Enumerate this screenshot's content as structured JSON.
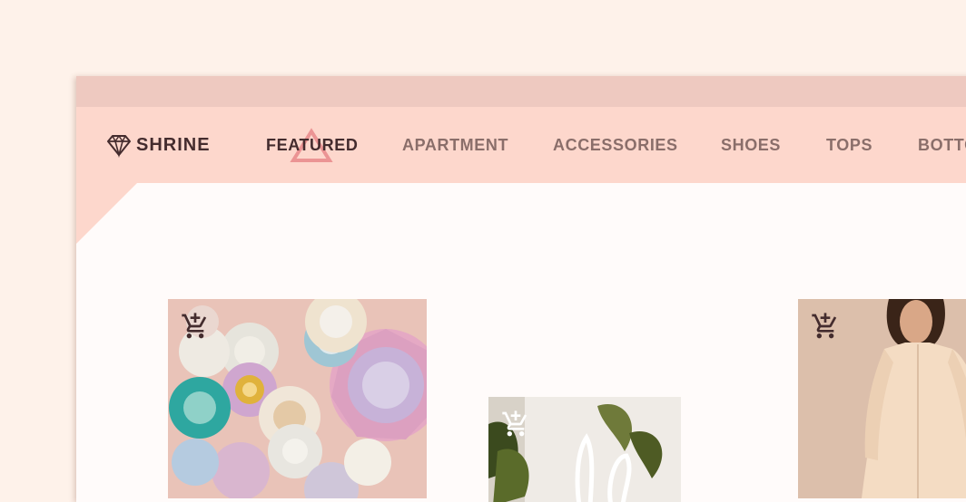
{
  "brand": {
    "name": "SHRINE",
    "logo_icon": "diamond-icon"
  },
  "nav": {
    "items": [
      {
        "label": "FEATURED",
        "active": true
      },
      {
        "label": "APARTMENT",
        "active": false
      },
      {
        "label": "ACCESSORIES",
        "active": false
      },
      {
        "label": "SHOES",
        "active": false
      },
      {
        "label": "TOPS",
        "active": false
      },
      {
        "label": "BOTTOMS",
        "active": false
      }
    ],
    "indicator_icon": "triangle-outline-icon"
  },
  "products": [
    {
      "image": "teacups-and-saucers",
      "cart_icon": "add-shopping-cart-icon"
    },
    {
      "image": "monstera-plant-with-vase",
      "cart_icon": "add-shopping-cart-icon"
    },
    {
      "image": "woman-in-cream-shirt",
      "cart_icon": "add-shopping-cart-icon"
    }
  ],
  "colors": {
    "background": "#fef2ea",
    "header": "#fdd7cc",
    "titlebar": "#eec9c0",
    "content": "#fffbfa",
    "text_primary": "#442c2e",
    "text_secondary": "#8a6e6a",
    "indicator": "#e8888a"
  }
}
